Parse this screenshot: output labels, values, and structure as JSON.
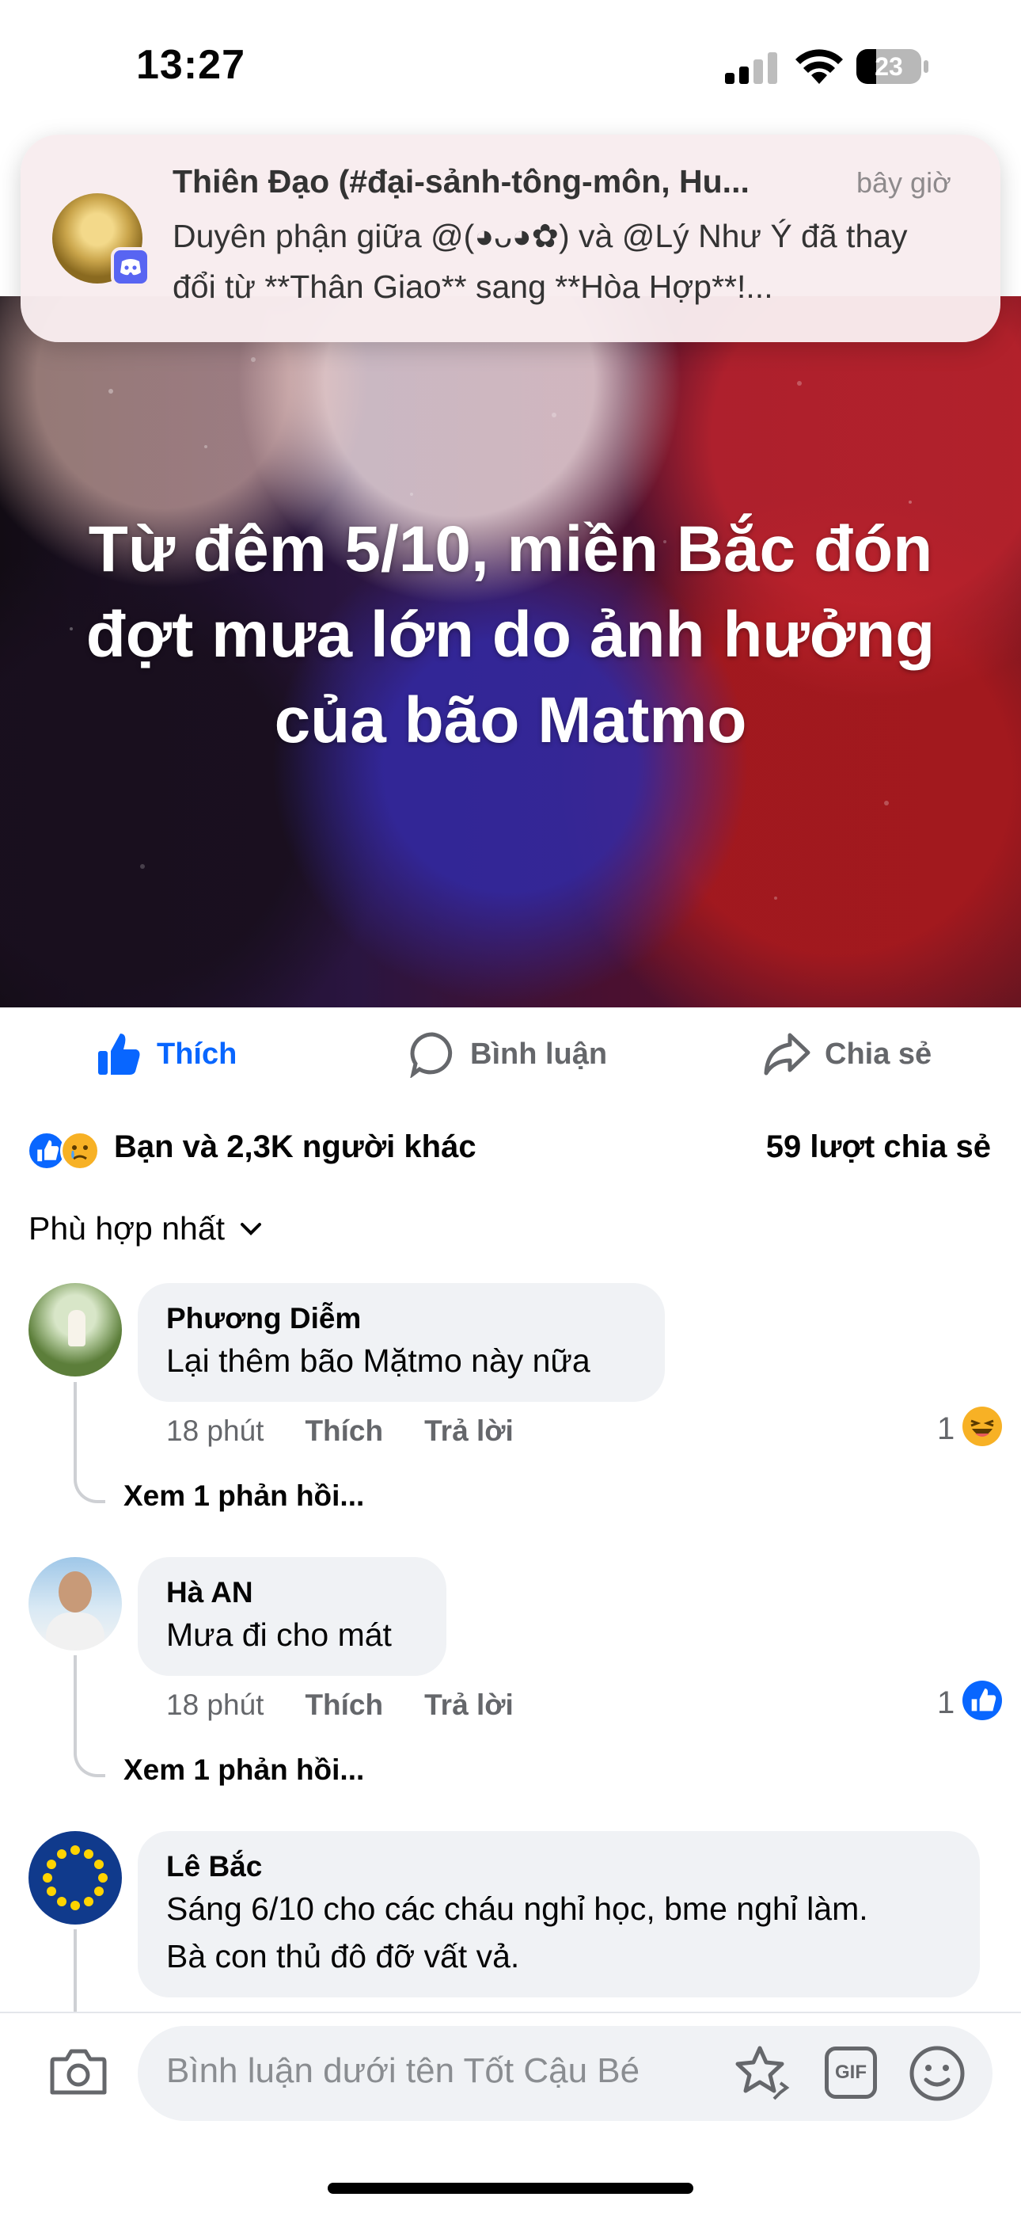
{
  "status_bar": {
    "time": "13:27",
    "battery": "23"
  },
  "notification": {
    "title": "Thiên Đạo (#đại-sảnh-tông-môn, Hu...",
    "time": "bây giờ",
    "body_line1": "Duyên phận giữa @(◕ᴗ◕✿) và @Lý Như Ý đã thay",
    "body_line2": "đổi từ **Thân Giao** sang **Hòa Hợp**!..."
  },
  "post": {
    "headline": "Từ đêm 5/10, miền Bắc đón đợt mưa lớn do ảnh hưởng của bão Matmo"
  },
  "actions": {
    "like": "Thích",
    "comment": "Bình luận",
    "share": "Chia sẻ"
  },
  "summary": {
    "reactions": "Bạn và 2,3K người khác",
    "shares": "59 lượt chia sẻ"
  },
  "sort_label": "Phù hợp nhất",
  "comments": [
    {
      "name": "Phương Diễm",
      "text": "Lại thêm bão Mặtmo này nữa",
      "time": "18 phút",
      "like": "Thích",
      "reply": "Trả lời",
      "reaction_count": "1",
      "reaction_icon": "laugh-icon",
      "view_replies": "Xem 1 phản hồi..."
    },
    {
      "name": "Hà AN",
      "text": "Mưa đi cho mát",
      "time": "18 phút",
      "like": "Thích",
      "reply": "Trả lời",
      "reaction_count": "1",
      "reaction_icon": "like-icon",
      "view_replies": "Xem 1 phản hồi..."
    },
    {
      "name": "Lê Bắc",
      "text_line1": "Sáng 6/10 cho các cháu nghỉ học, bme nghỉ làm.",
      "text_line2": "Bà con thủ đô đỡ vất vả."
    }
  ],
  "composer": {
    "placeholder": "Bình luận dưới tên Tốt Cậu Bé"
  },
  "colors": {
    "accent": "#0866ff",
    "bubble": "#f0f2f5",
    "muted": "#65676b"
  }
}
